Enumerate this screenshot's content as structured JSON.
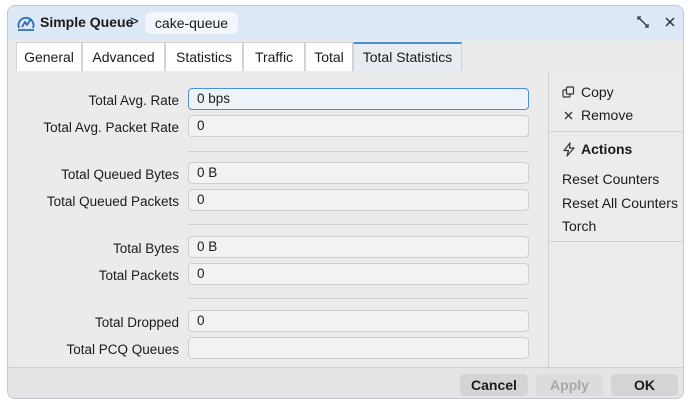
{
  "window": {
    "title": "Simple Queue",
    "separator": ">",
    "queue_name": "cake-queue"
  },
  "tabs": [
    {
      "label": "General"
    },
    {
      "label": "Advanced"
    },
    {
      "label": "Statistics"
    },
    {
      "label": "Traffic"
    },
    {
      "label": "Total"
    },
    {
      "label": "Total Statistics",
      "active": true
    }
  ],
  "fields": {
    "total_avg_rate": {
      "label": "Total Avg. Rate",
      "value": "0 bps"
    },
    "total_avg_packet_rate": {
      "label": "Total Avg. Packet Rate",
      "value": "0"
    },
    "total_queued_bytes": {
      "label": "Total Queued Bytes",
      "value": "0 B"
    },
    "total_queued_packets": {
      "label": "Total Queued Packets",
      "value": "0"
    },
    "total_bytes": {
      "label": "Total Bytes",
      "value": "0 B"
    },
    "total_packets": {
      "label": "Total Packets",
      "value": "0"
    },
    "total_dropped": {
      "label": "Total Dropped",
      "value": "0"
    },
    "total_pcq_queues": {
      "label": "Total PCQ Queues",
      "value": ""
    }
  },
  "side": {
    "copy": "Copy",
    "remove": "Remove",
    "actions_heading": "Actions",
    "reset_counters": "Reset Counters",
    "reset_all_counters": "Reset All Counters",
    "torch": "Torch"
  },
  "footer": {
    "cancel": "Cancel",
    "apply": "Apply",
    "ok": "OK"
  },
  "colors": {
    "titlebar": "#dce8f6",
    "accent": "#4a90d9"
  },
  "icons": {
    "title": "queue-gauge-icon",
    "pin": "pin-window-icon",
    "close": "close-icon",
    "copy": "copy-icon",
    "remove": "remove-icon",
    "actions": "lightning-icon"
  }
}
